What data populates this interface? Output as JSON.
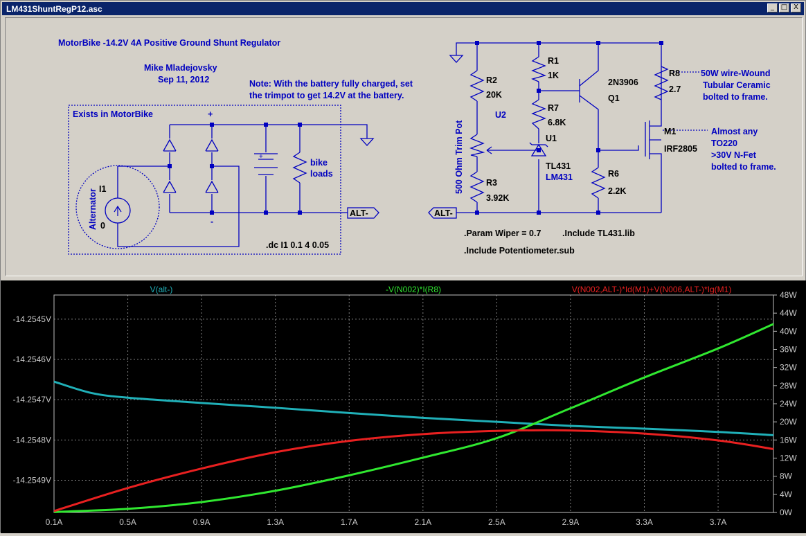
{
  "window": {
    "title": "LM431ShuntRegP12.asc",
    "buttons": {
      "minimize": "_",
      "maximize": "□",
      "close": "X"
    }
  },
  "schematic": {
    "heading": "MotorBike -14.2V 4A Positive Ground Shunt Regulator",
    "author": "Mike Mladejovsky",
    "date": "Sep 11, 2012",
    "note_line1": "Note: With the battery fully charged, set",
    "note_line2": "the trimpot to get 14.2V at the battery.",
    "box_label": "Exists in MotorBike",
    "plus": "+",
    "minus": "-",
    "bike_loads_1": "bike",
    "bike_loads_2": "loads",
    "alternator_label": "Alternator",
    "i1_name": "I1",
    "i1_value": "0",
    "dc_directive": ".dc I1 0.1 4 0.05",
    "alt_net_left": "ALT-",
    "alt_net_right": "ALT-",
    "r1_name": "R1",
    "r1_value": "1K",
    "r2_name": "R2",
    "r2_value": "20K",
    "r3_name": "R3",
    "r3_value": "3.92K",
    "r6_name": "R6",
    "r6_value": "2.2K",
    "r7_name": "R7",
    "r7_value": "6.8K",
    "r8_name": "R8",
    "r8_value": "2.7",
    "r8_note_1": "50W wire-Wound",
    "r8_note_2": "Tubular Ceramic",
    "r8_note_3": "bolted to frame.",
    "u1_name": "U1",
    "u1_part": "TL431",
    "u1_model": "LM431",
    "u2_name": "U2",
    "trimpot_label": "500 Ohm  Trim Pot",
    "q1_part": "2N3906",
    "q1_name": "Q1",
    "m1_name": "M1",
    "m1_part": "IRF2805",
    "m1_note_1": "Almost any",
    "m1_note_2": "TO220",
    "m1_note_3": ">30V N-Fet",
    "m1_note_4": "bolted to frame.",
    "param": ".Param Wiper = 0.7",
    "include1": ".Include TL431.lib",
    "include2": ".Include Potentiometer.sub"
  },
  "plot": {
    "trace_labels": {
      "cyan": "V(alt-)",
      "green": "-V(N002)*I(R8)",
      "red": "V(N002,ALT-)*Id(M1)+V(N006,ALT-)*Ig(M1)"
    },
    "left_ticks": [
      "-14.2545V",
      "-14.2546V",
      "-14.2547V",
      "-14.2548V",
      "-14.2549V"
    ],
    "right_ticks": [
      "48W",
      "44W",
      "40W",
      "36W",
      "32W",
      "28W",
      "24W",
      "20W",
      "16W",
      "12W",
      "8W",
      "4W",
      "0W"
    ],
    "x_ticks": [
      "0.1A",
      "0.5A",
      "0.9A",
      "1.3A",
      "1.7A",
      "2.1A",
      "2.5A",
      "2.9A",
      "3.3A",
      "3.7A"
    ]
  },
  "chart_data": {
    "type": "line",
    "xlabel": "",
    "xlim": [
      0.1,
      4.0
    ],
    "ylim_left": [
      -14.25498,
      -14.25444
    ],
    "ylim_right": [
      0,
      48
    ],
    "grid": true,
    "series": [
      {
        "name": "V(alt-)",
        "axis": "left",
        "color": "#20b0b8",
        "x": [
          0.1,
          0.3,
          0.5,
          0.9,
          1.3,
          1.7,
          2.1,
          2.5,
          2.9,
          3.3,
          3.7,
          4.0
        ],
        "values": [
          -14.254655,
          -14.254683,
          -14.254695,
          -14.254708,
          -14.25472,
          -14.254733,
          -14.254745,
          -14.254755,
          -14.254765,
          -14.254772,
          -14.25478,
          -14.254788
        ]
      },
      {
        "name": "-V(N002)*I(R8)",
        "axis": "right",
        "color": "#30e830",
        "x": [
          0.1,
          0.5,
          0.9,
          1.3,
          1.7,
          2.1,
          2.5,
          2.9,
          3.3,
          3.7,
          4.0
        ],
        "values": [
          0.1,
          0.8,
          2.3,
          4.8,
          8.2,
          12.1,
          16.4,
          23.0,
          29.8,
          36.2,
          41.6
        ]
      },
      {
        "name": "V(N002,ALT-)*Id(M1)+V(N006,ALT-)*Ig(M1)",
        "axis": "right",
        "color": "#e82020",
        "x": [
          0.1,
          0.5,
          0.9,
          1.3,
          1.7,
          2.1,
          2.5,
          2.9,
          3.3,
          3.7,
          4.0
        ],
        "values": [
          0.3,
          5.4,
          9.7,
          13.3,
          15.8,
          17.3,
          18.0,
          18.1,
          17.4,
          15.9,
          14.0
        ]
      }
    ]
  }
}
